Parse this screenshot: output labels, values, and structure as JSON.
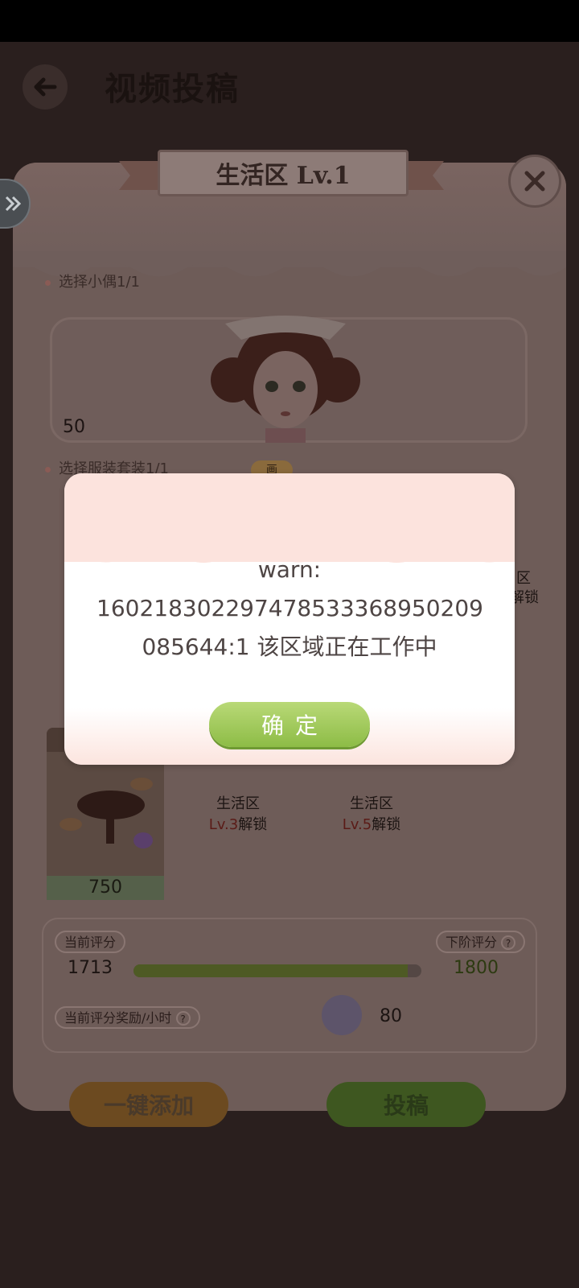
{
  "page": {
    "title": "视频投稿"
  },
  "panel": {
    "ribbon_title": "生活区 Lv.1",
    "section_doll": "选择小偶1/1",
    "doll_value": "50",
    "section_outfit": "选择服装套装1/1",
    "outfit_badge": "画",
    "behind_right_top": "区",
    "behind_right_bottom": "解锁",
    "furniture_value": "750",
    "zones": [
      {
        "name": "生活区",
        "level": "Lv.3",
        "suffix": "解锁"
      },
      {
        "name": "生活区",
        "level": "Lv.5",
        "suffix": "解锁"
      }
    ]
  },
  "score": {
    "current_label": "当前评分",
    "current_value": "1713",
    "next_label": "下阶评分",
    "next_value": "1800",
    "progress": 0.952,
    "reward_label": "当前评分奖励/小时",
    "reward_value": "80"
  },
  "buttons": {
    "add_all": "一键添加",
    "submit": "投稿"
  },
  "dialog": {
    "line1": "warn:",
    "line2": "160218302297478533368950209",
    "line3": "085644:1 该区域正在工作中",
    "ok": "确定"
  }
}
